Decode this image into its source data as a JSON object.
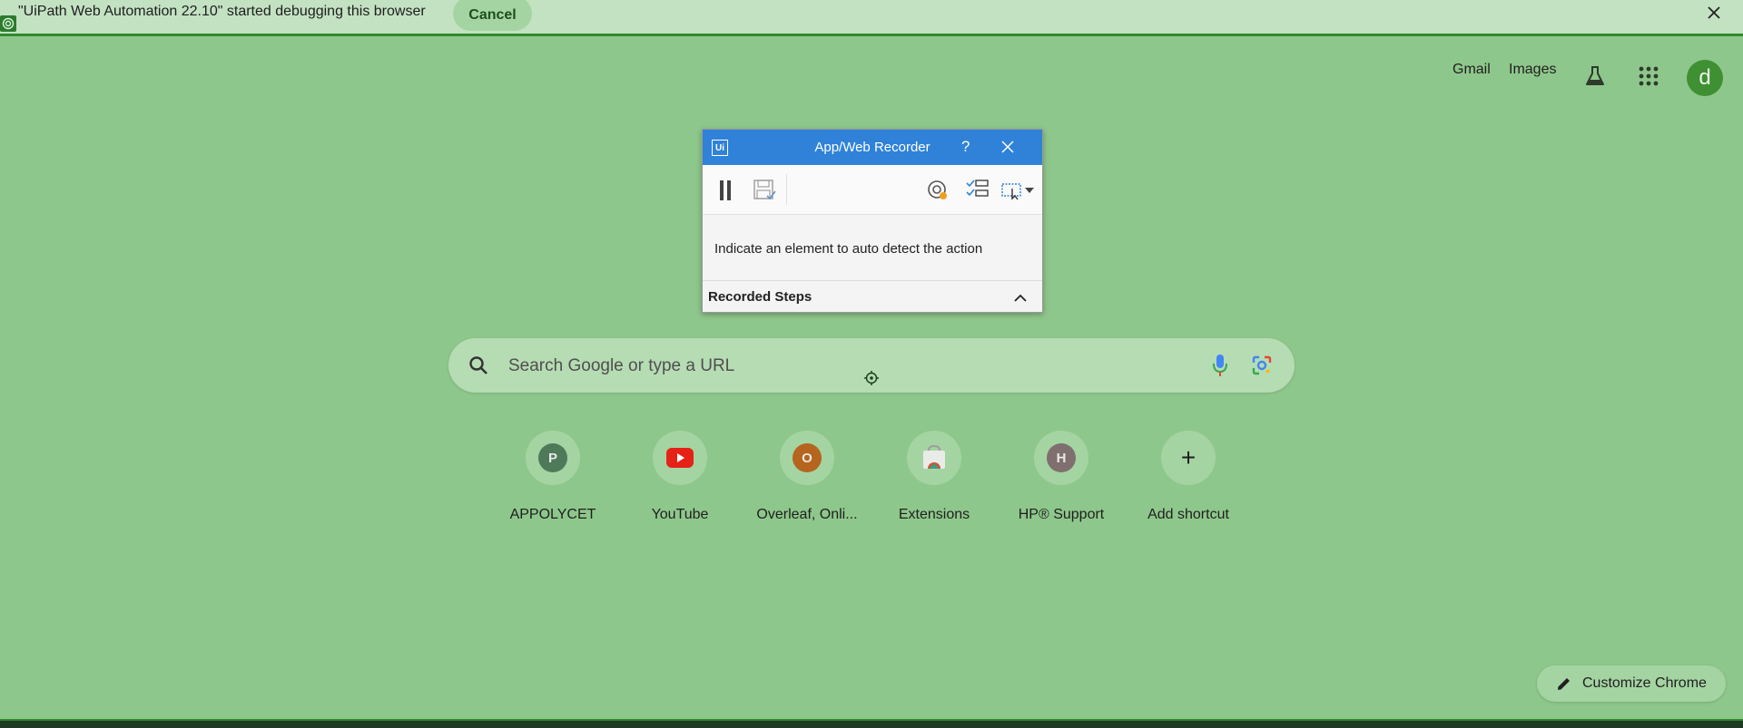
{
  "debug_bar": {
    "message": "\"UiPath Web Automation 22.10\" started debugging this browser",
    "cancel_label": "Cancel"
  },
  "header": {
    "gmail": "Gmail",
    "images": "Images",
    "avatar_letter": "d",
    "icons": [
      "labs-icon",
      "apps-grid-icon"
    ]
  },
  "recorder": {
    "logo": "Ui",
    "title": "App/Web Recorder",
    "help": "?",
    "instruction": "Indicate an element to auto detect the action",
    "steps_label": "Recorded Steps",
    "toolbar_icons": [
      "pause-icon",
      "save-icon",
      "target-icon",
      "checklist-icon",
      "screen-select-icon"
    ]
  },
  "search": {
    "placeholder": "Search Google or type a URL"
  },
  "shortcuts": [
    {
      "label": "APPOLYCET",
      "letter": "P",
      "color": "#4f7a5a"
    },
    {
      "label": "YouTube",
      "letter": "",
      "color": "#e62117"
    },
    {
      "label": "Overleaf, Onli...",
      "letter": "O",
      "color": "#b5651d"
    },
    {
      "label": "Extensions",
      "letter": "",
      "color": "#9bbf9a"
    },
    {
      "label": "HP® Support",
      "letter": "H",
      "color": "#7f6f6f"
    },
    {
      "label": "Add shortcut",
      "letter": "+",
      "color": ""
    }
  ],
  "customize": {
    "label": "Customize Chrome"
  },
  "colors": {
    "page_bg": "#8ec78b",
    "debug_bar_bg": "#c3e2c2",
    "recorder_titlebar": "#2f82d8",
    "avatar": "#3f8f33"
  }
}
